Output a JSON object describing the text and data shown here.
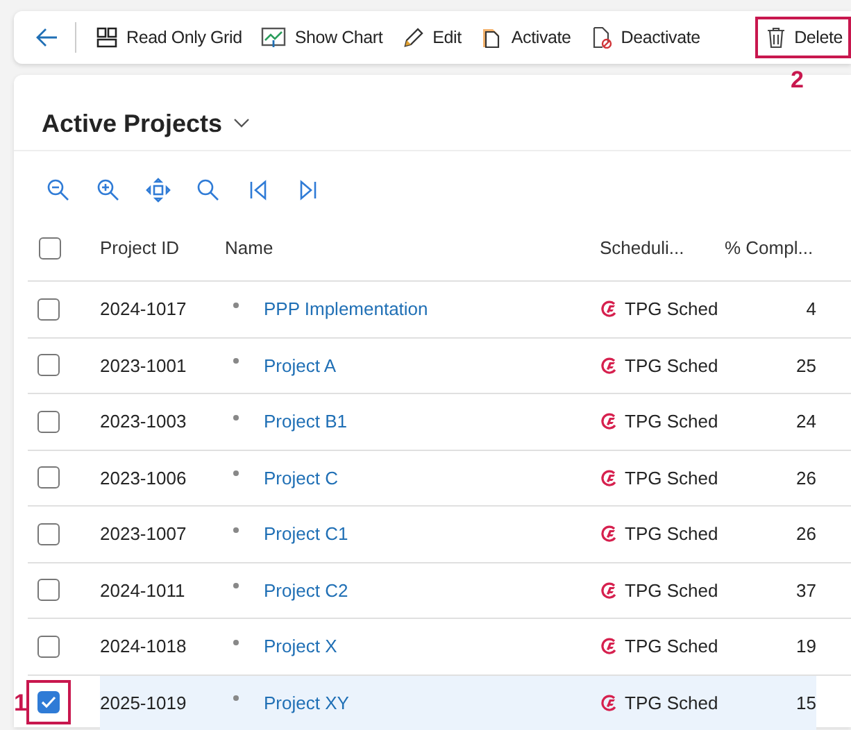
{
  "toolbar": {
    "items": [
      {
        "kind": "back"
      },
      {
        "kind": "grid",
        "label": "Read Only Grid",
        "highlighted": false
      },
      {
        "kind": "chart",
        "label": "Show Chart",
        "highlighted": false
      },
      {
        "kind": "edit",
        "label": "Edit",
        "highlighted": false
      },
      {
        "kind": "activate",
        "label": "Activate",
        "highlighted": false
      },
      {
        "kind": "deactivate",
        "label": "Deactivate",
        "highlighted": false
      },
      {
        "kind": "delete",
        "label": "Delete",
        "highlighted": true,
        "callout": "2"
      }
    ]
  },
  "view": {
    "title": "Active Projects"
  },
  "gantt_tools": [
    {
      "kind": "zoom-out"
    },
    {
      "kind": "zoom-in"
    },
    {
      "kind": "fit"
    },
    {
      "kind": "search"
    },
    {
      "kind": "first"
    },
    {
      "kind": "last"
    }
  ],
  "table": {
    "columns": [
      "Project ID",
      "Name",
      "Scheduli...",
      "% Compl..."
    ],
    "header_checked": false,
    "rows": [
      {
        "id": "2024-1017",
        "name": "PPP Implementation",
        "scheduling": "TPG Sched",
        "complete": "4",
        "selected": false
      },
      {
        "id": "2023-1001",
        "name": "Project A",
        "scheduling": "TPG Sched",
        "complete": "25",
        "selected": false
      },
      {
        "id": "2023-1003",
        "name": "Project B1",
        "scheduling": "TPG Sched",
        "complete": "24",
        "selected": false
      },
      {
        "id": "2023-1006",
        "name": "Project C",
        "scheduling": "TPG Sched",
        "complete": "26",
        "selected": false
      },
      {
        "id": "2023-1007",
        "name": "Project C1",
        "scheduling": "TPG Sched",
        "complete": "26",
        "selected": false
      },
      {
        "id": "2024-1011",
        "name": "Project C2",
        "scheduling": "TPG Sched",
        "complete": "37",
        "selected": false
      },
      {
        "id": "2024-1018",
        "name": "Project X",
        "scheduling": "TPG Sched",
        "complete": "19",
        "selected": false
      },
      {
        "id": "2025-1019",
        "name": "Project XY",
        "scheduling": "TPG Sched",
        "complete": "15",
        "selected": true,
        "callout": "1"
      }
    ]
  }
}
